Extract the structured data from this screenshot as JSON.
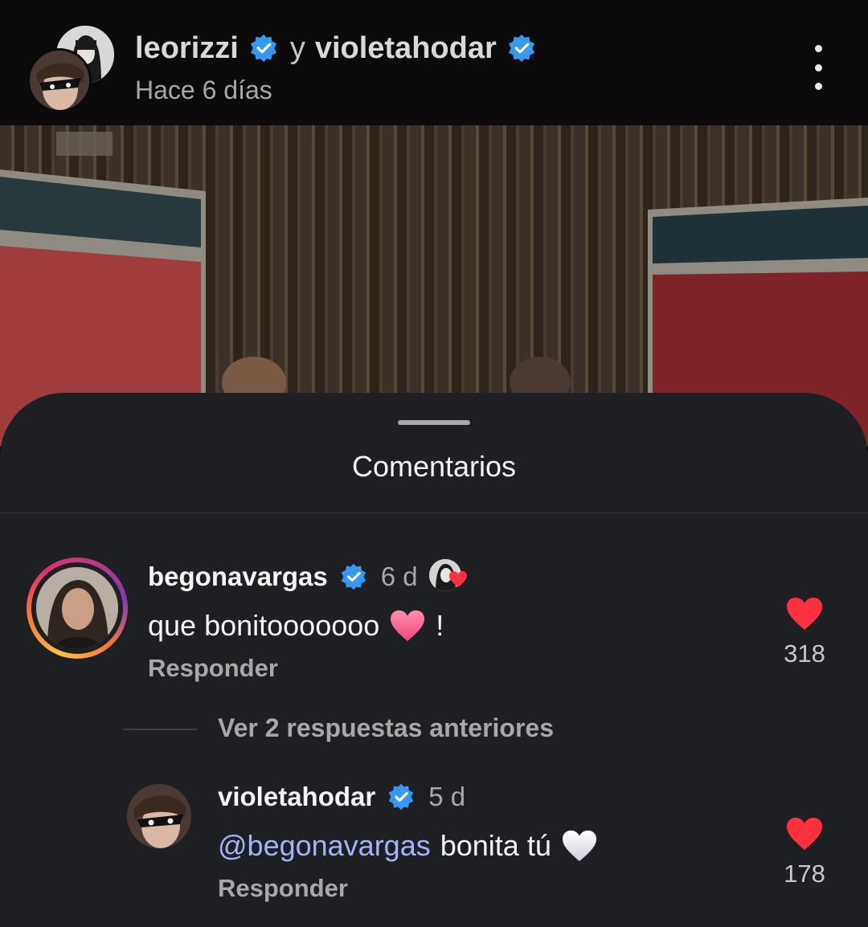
{
  "header": {
    "user1": "leorizzi",
    "connector": "y",
    "user2": "violetahodar",
    "time": "Hace 6 días"
  },
  "sheet": {
    "title": "Comentarios"
  },
  "comment": {
    "username": "begonavargas",
    "age": "6 d",
    "text": "que bonitooooooo",
    "emoji": "❤",
    "suffix": "!",
    "reply": "Responder",
    "likes": "318"
  },
  "view_more": "Ver 2 respuestas anteriores",
  "reply_comment": {
    "username": "violetahodar",
    "age": "5 d",
    "mention": "@begonavargas",
    "text": "bonita tú",
    "emoji": "🤍",
    "reply": "Responder",
    "likes": "178"
  },
  "colors": {
    "verified": "#3897f0",
    "like": "#ff3040",
    "mention": "#a3b4f7",
    "sheet": "#1d1f22"
  }
}
